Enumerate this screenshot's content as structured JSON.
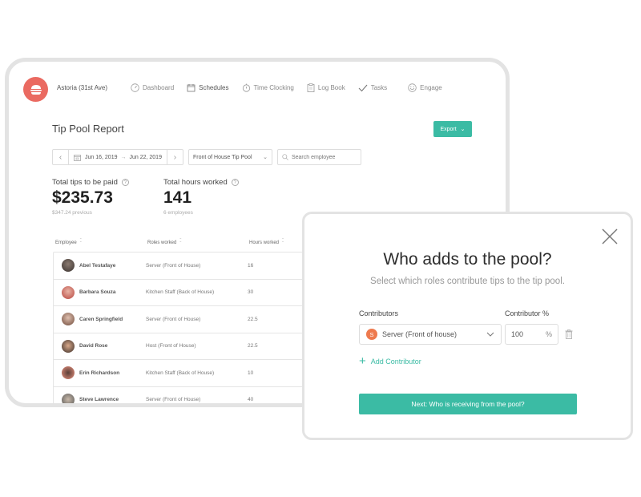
{
  "app": {
    "location": "Astoria (31st Ave)",
    "brand_color": "#ea6a61",
    "accent_color": "#3bbba4"
  },
  "nav": [
    {
      "label": "Dashboard",
      "icon": "dashboard-icon"
    },
    {
      "label": "Schedules",
      "icon": "calendar-icon",
      "active": true
    },
    {
      "label": "Time Clocking",
      "icon": "stopwatch-icon"
    },
    {
      "label": "Log Book",
      "icon": "clipboard-icon"
    },
    {
      "label": "Tasks",
      "icon": "check-icon"
    },
    {
      "label": "Engage",
      "icon": "smiley-icon"
    }
  ],
  "report": {
    "title": "Tip Pool Report",
    "export_label": "Export",
    "date_start": "Jun 16, 2019",
    "date_end": "Jun 22, 2019",
    "pool_selected": "Front of House Tip Pool",
    "search_placeholder": "Search employee"
  },
  "stats": {
    "tips": {
      "label": "Total tips to be paid",
      "value": "$235.73",
      "sub": "$347.24 previous"
    },
    "hours": {
      "label": "Total hours worked",
      "value": "141",
      "sub": "6 employees"
    }
  },
  "table": {
    "columns": [
      "Employee",
      "Roles worked",
      "Hours worked"
    ],
    "rows": [
      {
        "name": "Abel Testafaye",
        "role": "Server (Front of House)",
        "hours": "16"
      },
      {
        "name": "Barbara Souza",
        "role": "Kitchen Staff (Back of House)",
        "hours": "30"
      },
      {
        "name": "Caren Springfield",
        "role": "Server (Front of House)",
        "hours": "22.5"
      },
      {
        "name": "David Rose",
        "role": "Host (Front of House)",
        "hours": "22.5"
      },
      {
        "name": "Erin Richardson",
        "role": "Kitchen Staff (Back of House)",
        "hours": "10"
      },
      {
        "name": "Steve Lawrence",
        "role": "Server (Front of House)",
        "hours": "40"
      }
    ]
  },
  "modal": {
    "title": "Who adds to the pool?",
    "subtitle": "Select which roles contribute tips to the tip pool.",
    "contributors_label": "Contributors",
    "percent_label": "Contributor %",
    "contributor": {
      "badge": "S",
      "role": "Server (Front of house)",
      "percent": "100",
      "percent_sign": "%"
    },
    "add_label": "Add Contributor",
    "next_label": "Next: Who is receiving from the pool?"
  }
}
